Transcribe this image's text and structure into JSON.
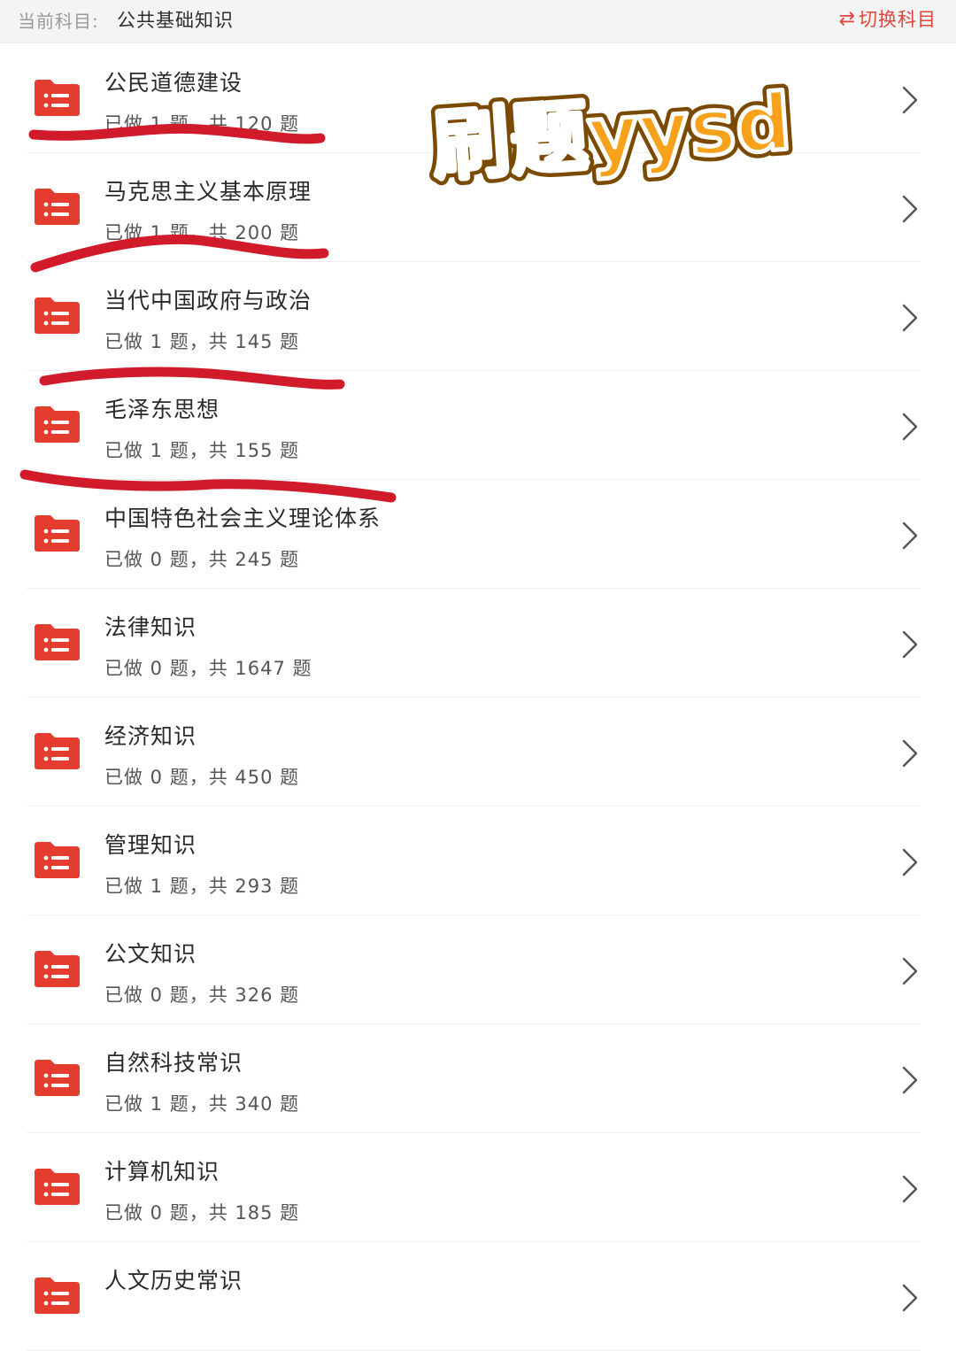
{
  "header": {
    "current_label": "当前科目:",
    "current_subject": "公共基础知识",
    "switch_label": "切换科目",
    "switch_icon": "⇄"
  },
  "colors": {
    "accent": "#e0463a",
    "folder": "#e53c30",
    "watermark_fill": "#f7a21a",
    "annotation": "#d11a2a"
  },
  "icons": {
    "folder": "folder-list-icon",
    "chevron": "chevron-right-icon",
    "switch": "swap-arrows-icon"
  },
  "watermark": {
    "text": "刷题yysd"
  },
  "subjects": [
    {
      "title": "公民道德建设",
      "progress": "已做 1 题，共 120 题",
      "done": 1,
      "total": 120
    },
    {
      "title": "马克思主义基本原理",
      "progress": "已做 1 题，共 200 题",
      "done": 1,
      "total": 200
    },
    {
      "title": "当代中国政府与政治",
      "progress": "已做 1 题，共 145 题",
      "done": 1,
      "total": 145
    },
    {
      "title": "毛泽东思想",
      "progress": "已做 1 题，共 155 题",
      "done": 1,
      "total": 155
    },
    {
      "title": "中国特色社会主义理论体系",
      "progress": "已做 0 题，共 245 题",
      "done": 0,
      "total": 245
    },
    {
      "title": "法律知识",
      "progress": "已做 0 题，共 1647 题",
      "done": 0,
      "total": 1647
    },
    {
      "title": "经济知识",
      "progress": "已做 0 题，共 450 题",
      "done": 0,
      "total": 450
    },
    {
      "title": "管理知识",
      "progress": "已做 1 题，共 293 题",
      "done": 1,
      "total": 293
    },
    {
      "title": "公文知识",
      "progress": "已做 0 题，共 326 题",
      "done": 0,
      "total": 326
    },
    {
      "title": "自然科技常识",
      "progress": "已做 1 题，共 340 题",
      "done": 1,
      "total": 340
    },
    {
      "title": "计算机知识",
      "progress": "已做 0 题，共 185 题",
      "done": 0,
      "total": 185
    },
    {
      "title": "人文历史常识",
      "progress": "",
      "done": null,
      "total": null
    }
  ]
}
